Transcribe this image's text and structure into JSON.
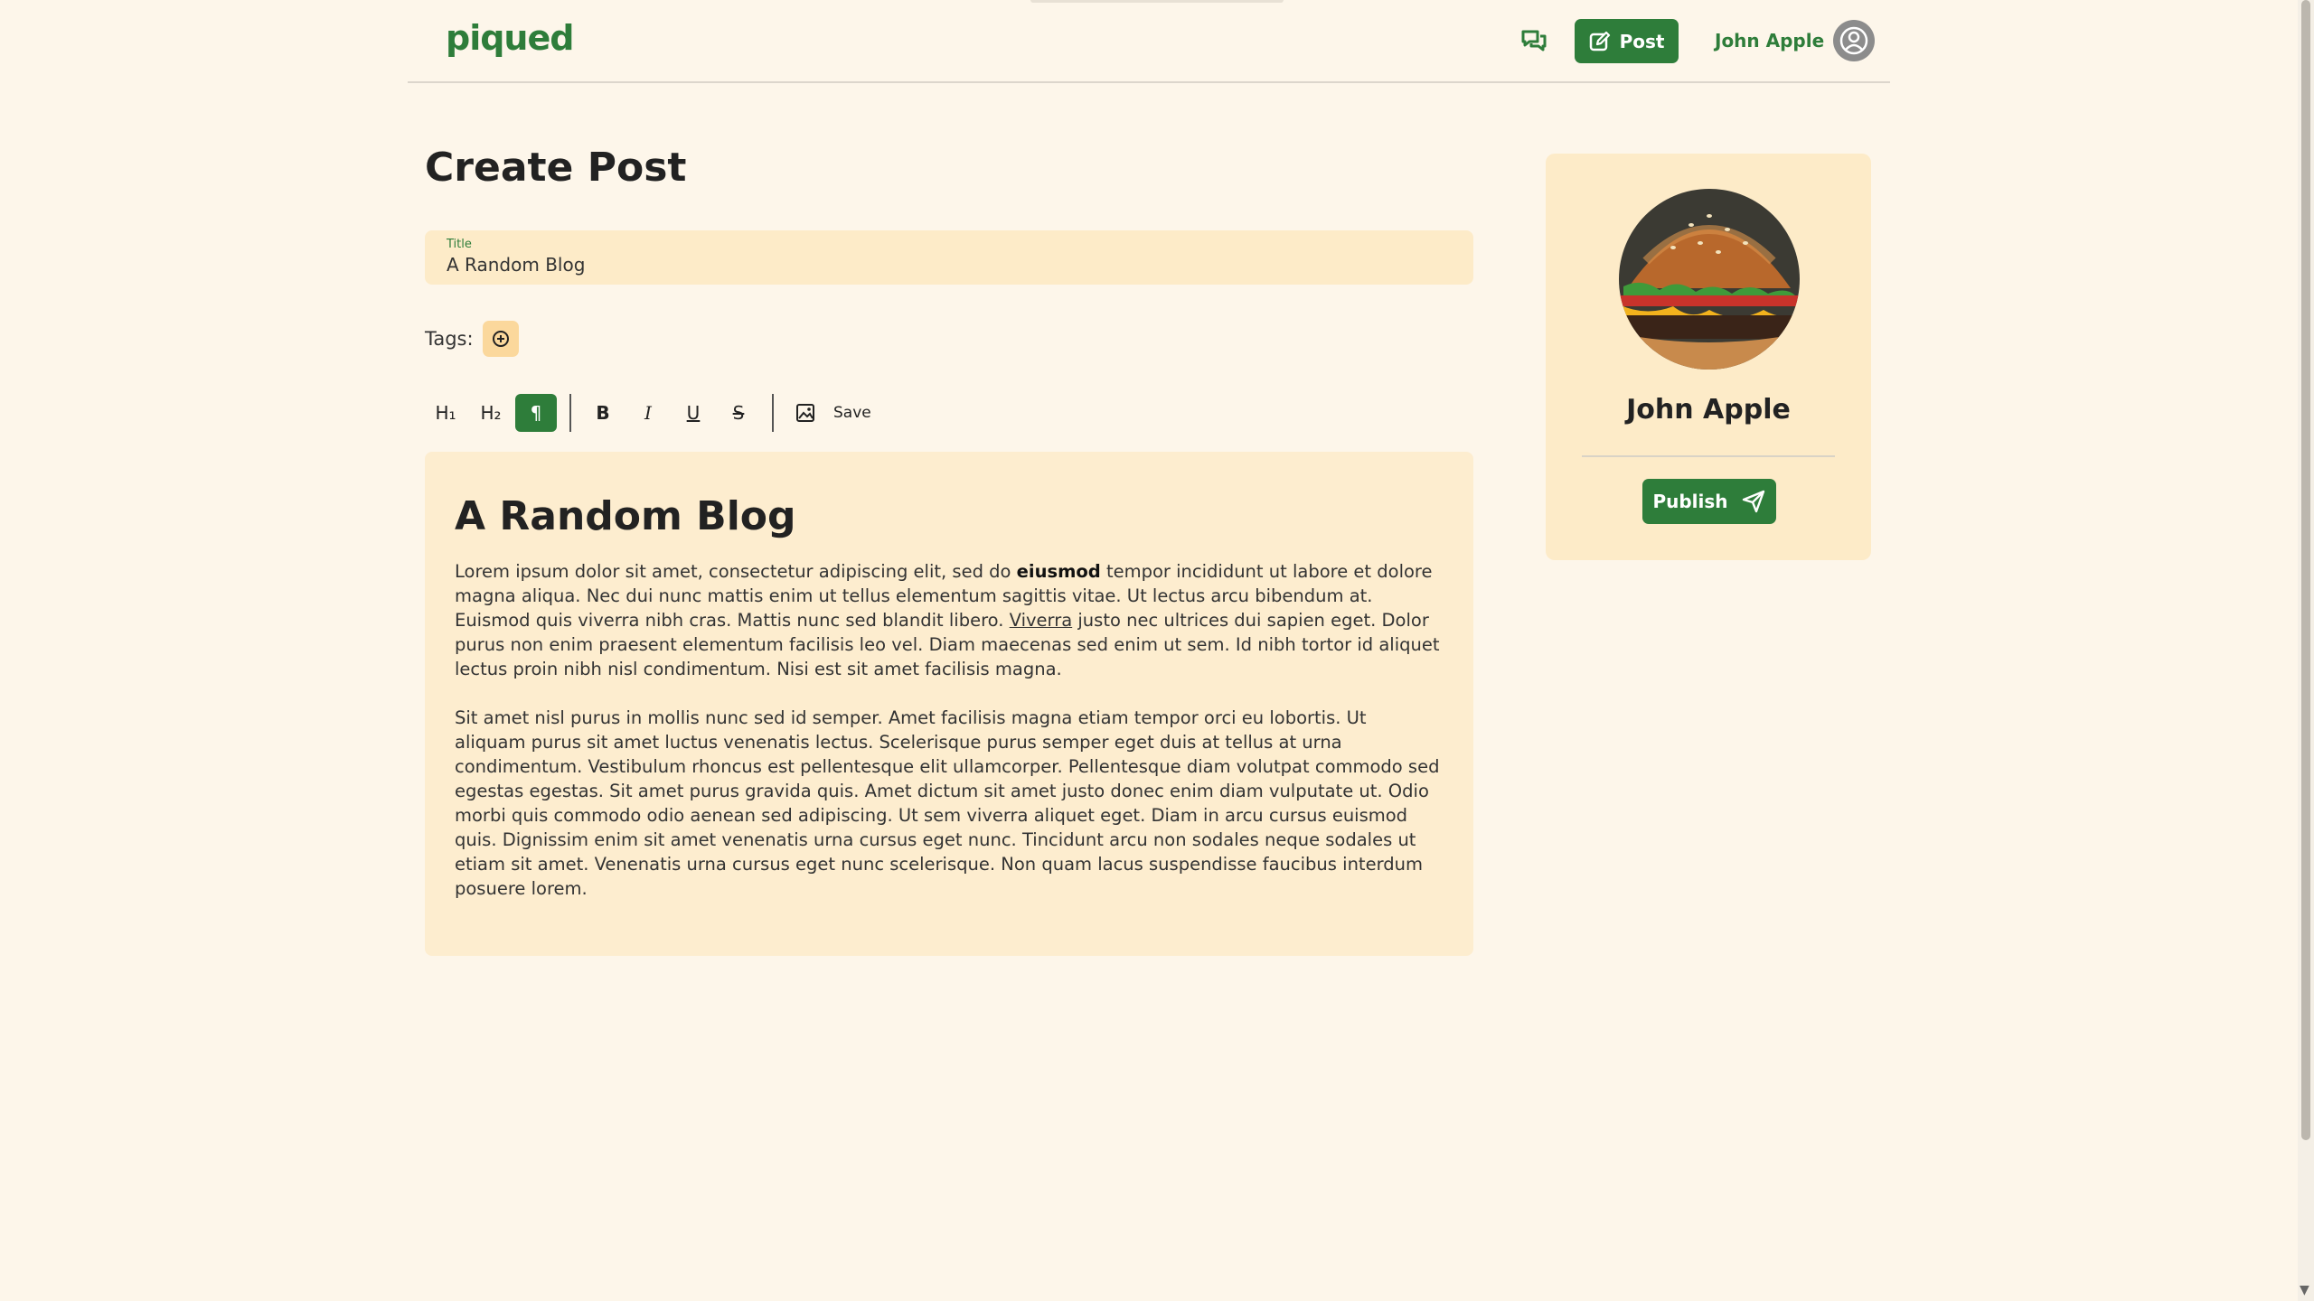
{
  "header": {
    "logo": "piqued",
    "post_label": "Post",
    "user_name": "John Apple"
  },
  "main": {
    "page_title": "Create Post",
    "title_field": {
      "label": "Title",
      "value": "A Random Blog"
    },
    "tags_label": "Tags:",
    "toolbar": {
      "h1": "H₁",
      "h2": "H₂",
      "paragraph": "¶",
      "bold": "B",
      "italic": "I",
      "underline": "U",
      "strike": "S",
      "save_label": "Save"
    },
    "editor": {
      "heading": "A Random Blog",
      "p1_a": "Lorem ipsum dolor sit amet, consectetur adipiscing elit, sed do ",
      "p1_bold": "eiusmod",
      "p1_b": " tempor incididunt ut labore et dolore magna aliqua. Nec dui nunc mattis enim ut tellus elementum sagittis vitae. Ut lectus arcu bibendum at. Euismod quis viverra nibh cras. Mattis nunc sed blandit libero. ",
      "p1_underline": "Viverra",
      "p1_c": " justo nec ultrices dui sapien eget. Dolor purus non enim praesent elementum facilisis leo vel. Diam maecenas sed enim ut sem. Id nibh tortor id aliquet lectus proin nibh nisl condimentum. Nisi est sit amet facilisis magna.",
      "p2": "Sit amet nisl purus in mollis nunc sed id semper. Amet facilisis magna etiam tempor orci eu lobortis. Ut aliquam purus sit amet luctus venenatis lectus. Scelerisque purus semper eget duis at tellus at urna condimentum. Vestibulum rhoncus est pellentesque elit ullamcorper. Pellentesque diam volutpat commodo sed egestas egestas. Sit amet purus gravida quis. Amet dictum sit amet justo donec enim diam vulputate ut. Odio morbi quis commodo odio aenean sed adipiscing. Ut sem viverra aliquet eget. Diam in arcu cursus euismod quis. Dignissim enim sit amet venenatis urna cursus eget nunc. Tincidunt arcu non sodales neque sodales ut etiam sit amet. Venenatis urna cursus eget nunc scelerisque. Non quam lacus suspendisse faucibus interdum posuere lorem."
    }
  },
  "profile_card": {
    "name": "John Apple",
    "publish_label": "Publish"
  },
  "colors": {
    "brand": "#2e7d3a",
    "background": "#fdf6ea",
    "field": "#fdebc8",
    "tag_button": "#fbd89c"
  },
  "icons": {
    "chat": "chat-icon",
    "post": "edit-icon",
    "avatar": "user-icon",
    "add_tag": "plus-circle-icon",
    "image": "image-icon",
    "publish": "send-icon"
  }
}
